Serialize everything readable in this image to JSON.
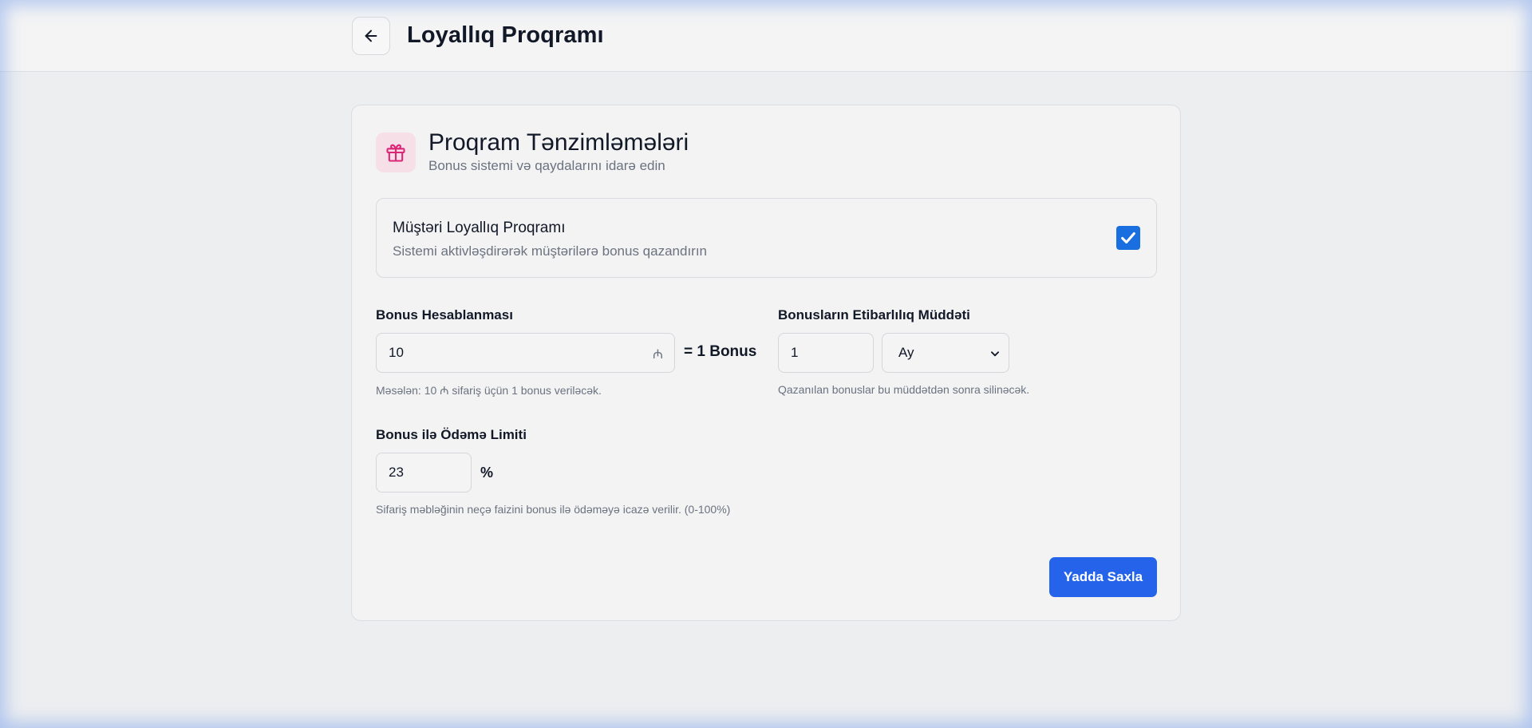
{
  "header": {
    "title": "Loyallıq Proqramı",
    "back_icon": "arrow-left-icon"
  },
  "card": {
    "icon": "gift-icon",
    "title": "Proqram Tənzimləmələri",
    "subtitle": "Bonus sistemi və qaydalarını idarə edin"
  },
  "toggle": {
    "title": "Müştəri Loyallıq Proqramı",
    "description": "Sistemi aktivləşdirərək müştərilərə bonus qazandırın",
    "checked": true
  },
  "bonus_calc": {
    "label": "Bonus Hesablanması",
    "value": "10",
    "currency_symbol": "₼",
    "equals_text": "= 1 Bonus",
    "hint": "Məsələn: 10 ₼ sifariş üçün 1 bonus veriləcək."
  },
  "validity": {
    "label": "Bonusların Etibarlılıq Müddəti",
    "value": "1",
    "unit_selected": "Ay",
    "hint": "Qazanılan bonuslar bu müddətdən sonra silinəcək."
  },
  "payment_limit": {
    "label": "Bonus ilə Ödəmə Limiti",
    "value": "23",
    "unit": "%",
    "hint": "Sifariş məbləğinin neçə faizini bonus ilə ödəməyə icazə verilir. (0-100%)"
  },
  "actions": {
    "save_label": "Yadda Saxla"
  },
  "colors": {
    "accent": "#2563eb",
    "checkbox": "#1a6fe0",
    "icon_pink": "#db2777",
    "icon_bg": "#f6dfe7"
  }
}
